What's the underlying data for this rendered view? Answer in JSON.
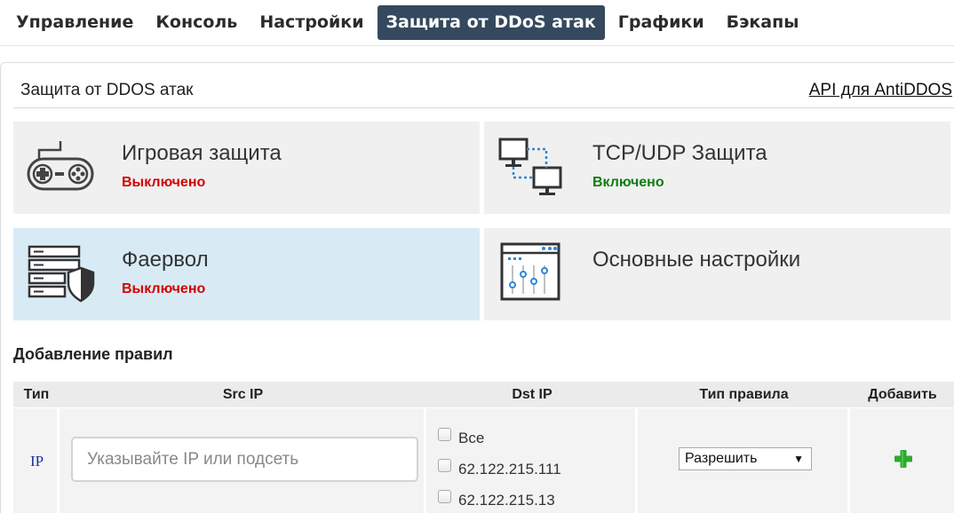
{
  "nav": {
    "items": [
      "Управление",
      "Консоль",
      "Настройки",
      "Защита от DDoS атак",
      "Графики",
      "Бэкапы"
    ],
    "active_index": 3
  },
  "panel": {
    "title": "Защита от DDOS атак",
    "api_link": "API для AntiDDOS"
  },
  "tiles": [
    {
      "title": "Игровая защита",
      "status": "Выключено",
      "status_type": "off",
      "icon": "gamepad-icon"
    },
    {
      "title": "TCP/UDP Защита",
      "status": "Включено",
      "status_type": "on",
      "icon": "network-icon"
    },
    {
      "title": "Фаервол",
      "status": "Выключено",
      "status_type": "off",
      "icon": "firewall-icon"
    },
    {
      "title": "Основные настройки",
      "status": "",
      "status_type": "",
      "icon": "settings-sliders-icon"
    }
  ],
  "rules": {
    "section_title": "Добавление правил",
    "headers": [
      "Тип",
      "Src IP",
      "Dst IP",
      "Тип правила",
      "Добавить"
    ],
    "row": {
      "type": "IP",
      "src_placeholder": "Указывайте IP или подсеть",
      "dst_options": [
        "Все",
        "62.122.215.111",
        "62.122.215.13"
      ],
      "rule_type": "Разрешить",
      "add_icon": "plus-icon"
    }
  },
  "colors": {
    "nav_active_bg": "#34495e",
    "status_off": "#d40000",
    "status_on": "#107c10",
    "highlight_tile": "#d8ebf5",
    "add_button": "#2eaa2e"
  }
}
